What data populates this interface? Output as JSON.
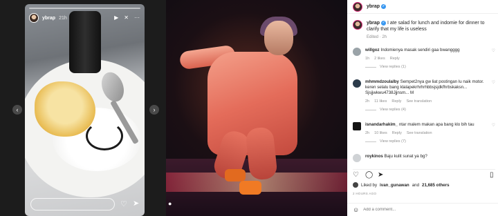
{
  "story": {
    "username": "ybrap",
    "time": "21h",
    "icons": [
      "play-icon",
      "mute-icon",
      "more-icon"
    ]
  },
  "photo": {},
  "post": {
    "header_username": "ybrap",
    "caption": {
      "username": "ybrap",
      "text": "I ate salad for lunch and indomie for dinner to clarify that my life is useless",
      "edited": "Edited · 2h"
    },
    "comments": [
      {
        "username": "willgoz",
        "text": "Indomienya masak sendiri gaa bwangggg",
        "time": "1h",
        "likes": "2 likes",
        "reply": "Reply",
        "translation": "",
        "view_replies": "View replies (1)"
      },
      {
        "username": "mhmmdzoulalby",
        "text": "Sempet2nya gw liat postingan lu naik motor. keren selalu bang klalapekrhrhrhbbsjsjdkfhrbskaksn... Sjsjjwkwu4738Jjjnsm... M",
        "time": "2h",
        "likes": "11 likes",
        "reply": "Reply",
        "translation": "See translation",
        "view_replies": "View replies (4)"
      },
      {
        "username": "isnandarhakim_",
        "text": "ntar malem makan apa bang klo bih tau",
        "time": "2h",
        "likes": "10 likes",
        "reply": "Reply",
        "translation": "See translation",
        "view_replies": "View replies (7)"
      },
      {
        "username": "roykinos",
        "text": "Baju kulit sunat ya bg?",
        "time": "",
        "likes": "",
        "reply": "",
        "translation": "",
        "view_replies": ""
      }
    ],
    "liked_by": {
      "prefix": "Liked by",
      "user": "ivan_gunawan",
      "middle": "and",
      "others": "21,685 others"
    },
    "timestamp": "2 HOURS AGO",
    "add_comment_placeholder": "Add a comment...",
    "colors": {
      "verified": "#3897f0",
      "muted_text": "#8e8e8e"
    }
  }
}
